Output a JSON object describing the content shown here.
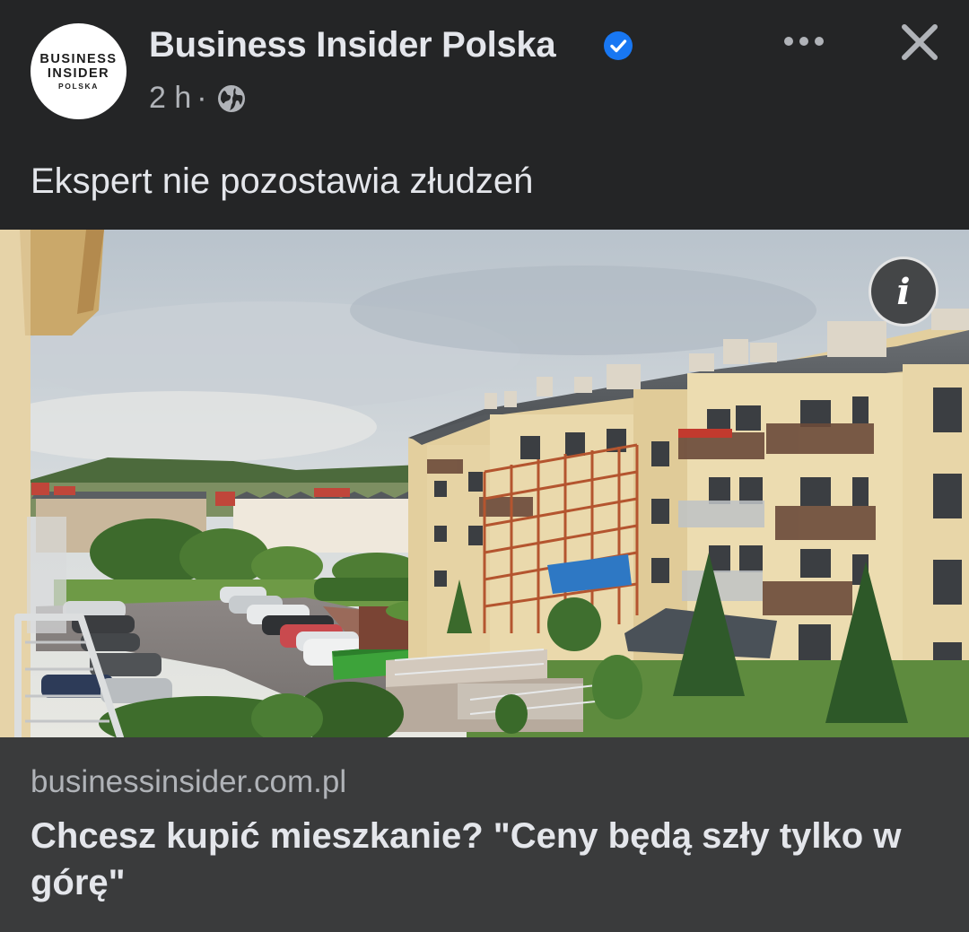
{
  "post": {
    "author": {
      "name": "Business Insider Polska",
      "avatar_line1": "BUSINESS",
      "avatar_line2": "INSIDER",
      "avatar_line3": "POLSKA",
      "verified_icon": "verified-badge-icon"
    },
    "time": "2 h",
    "separator": "·",
    "audience_icon": "globe-icon",
    "text": "Ekspert nie pozostawia złudzeń",
    "actions": {
      "more_icon": "more-options-icon",
      "close_icon": "close-icon"
    }
  },
  "image": {
    "description_icon": "info-icon",
    "info_glyph": "i"
  },
  "link_preview": {
    "domain": "businessinsider.com.pl",
    "title": "Chcesz kupić mieszkanie? \"Ceny będą szły tylko w górę\""
  },
  "colors": {
    "background": "#242526",
    "link_box": "#3a3b3c",
    "primary_text": "#e4e6eb",
    "secondary_text": "#b0b3b8",
    "verified_blue": "#1877f2"
  }
}
